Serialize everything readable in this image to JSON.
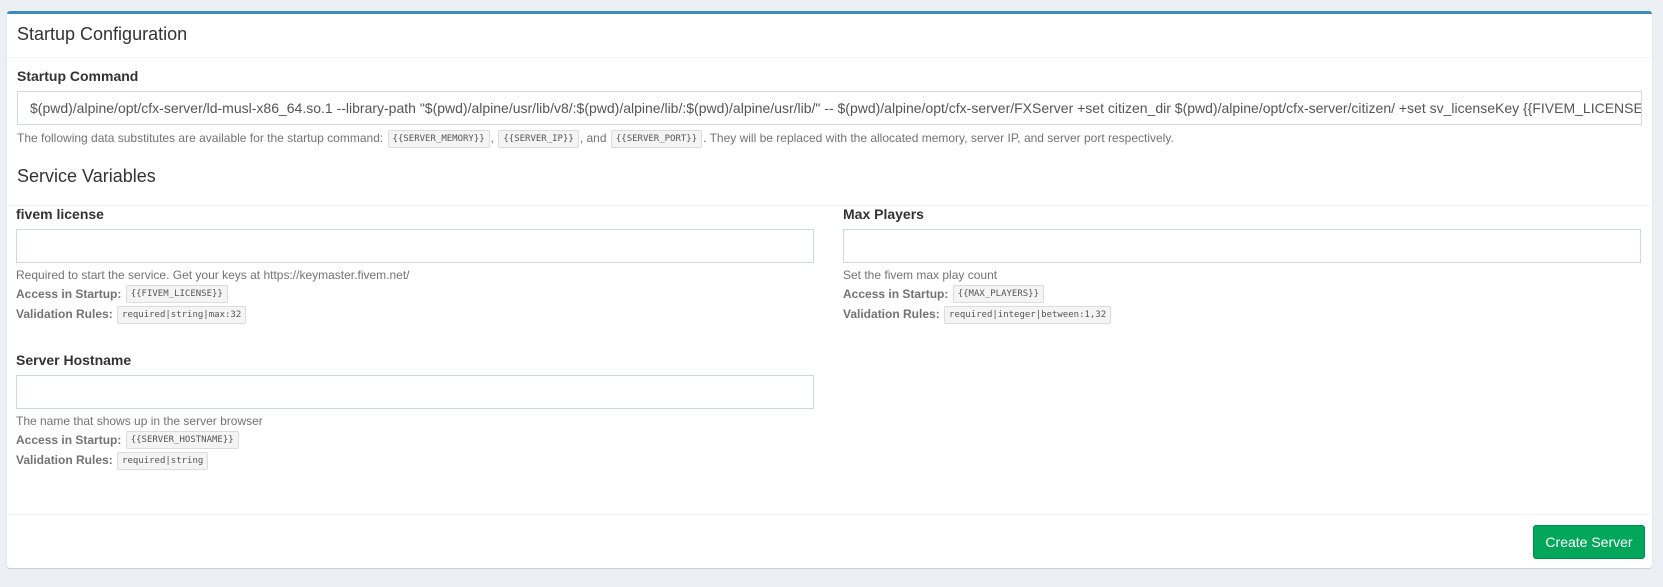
{
  "box": {
    "title": "Startup Configuration"
  },
  "startup": {
    "label": "Startup Command",
    "command": "$(pwd)/alpine/opt/cfx-server/ld-musl-x86_64.so.1 --library-path \"$(pwd)/alpine/usr/lib/v8/:$(pwd)/alpine/lib/:$(pwd)/alpine/usr/lib/\" -- $(pwd)/alpine/opt/cfx-server/FXServer +set citizen_dir $(pwd)/alpine/opt/cfx-server/citizen/ +set sv_licenseKey {{FIVEM_LICENSE}}",
    "help_prefix": "The following data substitutes are available for the startup command:",
    "sub_memory": "{{SERVER_MEMORY}}",
    "sep1": ",",
    "sub_ip": "{{SERVER_IP}}",
    "sep2": ", and",
    "sub_port": "{{SERVER_PORT}}",
    "help_suffix": ". They will be replaced with the allocated memory, server IP, and server port respectively."
  },
  "service_variables": {
    "title": "Service Variables",
    "access_label": "Access in Startup:",
    "rules_label": "Validation Rules:",
    "items": [
      {
        "label": "fivem license",
        "value": "",
        "description": "Required to start the service. Get your keys at https://keymaster.fivem.net/",
        "env": "{{FIVEM_LICENSE}}",
        "rules": "required|string|max:32"
      },
      {
        "label": "Max Players",
        "value": "",
        "description": "Set the fivem max play count",
        "env": "{{MAX_PLAYERS}}",
        "rules": "required|integer|between:1,32"
      },
      {
        "label": "Server Hostname",
        "value": "",
        "description": "The name that shows up in the server browser",
        "env": "{{SERVER_HOSTNAME}}",
        "rules": "required|string"
      }
    ]
  },
  "footer": {
    "create_label": "Create Server"
  },
  "colors": {
    "accent": "#3c8dbc",
    "success": "#00a65a",
    "background": "#ecf0f5"
  }
}
